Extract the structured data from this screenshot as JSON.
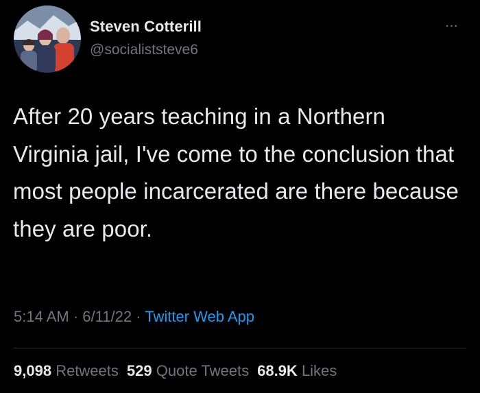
{
  "tweet": {
    "author": {
      "display_name": "Steven Cotterill",
      "handle": "@sociali­ststeve6"
    },
    "more_icon": "ellipsis-icon",
    "text": "After 20 years teaching in a Northern Virginia jail, I've come to the conclusion that most people incarcerated are there because they are poor.",
    "time": "5:14 AM",
    "separator1": " · ",
    "date": "6/11/22",
    "separator2": " · ",
    "source": "Twitter Web App",
    "stats": {
      "retweets_count": "9,098",
      "retweets_label": "Retweets",
      "quotes_count": "529",
      "quotes_label": "Quote Tweets",
      "likes_count": "68.9K",
      "likes_label": "Likes"
    }
  },
  "colors": {
    "background": "#000000",
    "primary_text": "#e7e9ea",
    "secondary_text": "#71767b",
    "link": "#1d9bf0",
    "divider": "#2f3336"
  }
}
